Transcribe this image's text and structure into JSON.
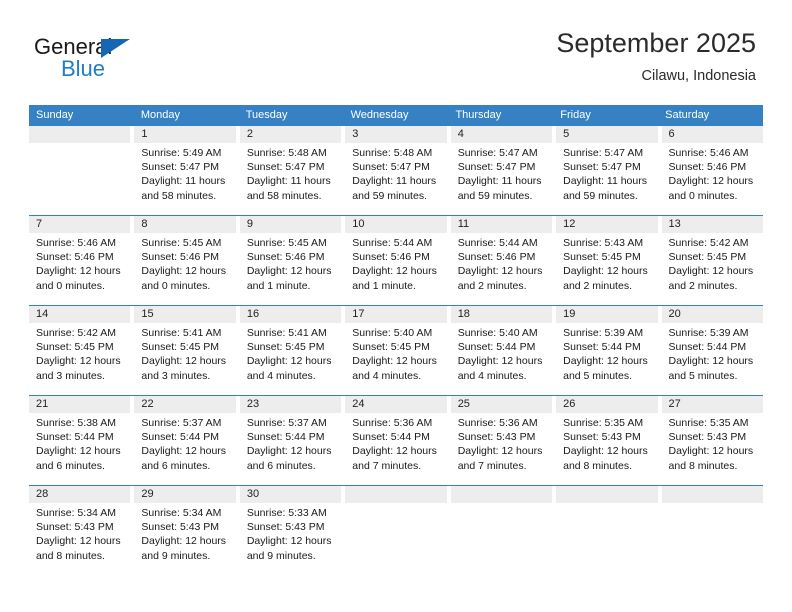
{
  "brand": {
    "name_part1": "General",
    "name_part2": "Blue",
    "triangle_icon": "blue-triangle-icon",
    "accent_color": "#1667b3",
    "blue_text_color": "#1f7ec4"
  },
  "header": {
    "title": "September 2025",
    "subtitle": "Cilawu, Indonesia"
  },
  "calendar": {
    "header_bg": "#3581c4",
    "date_band_bg": "#ededed",
    "weekdays": [
      "Sunday",
      "Monday",
      "Tuesday",
      "Wednesday",
      "Thursday",
      "Friday",
      "Saturday"
    ],
    "weeks": [
      [
        {
          "day": "",
          "sunrise": "",
          "sunset": "",
          "daylight_line1": "",
          "daylight_line2": ""
        },
        {
          "day": "1",
          "sunrise": "Sunrise: 5:49 AM",
          "sunset": "Sunset: 5:47 PM",
          "daylight_line1": "Daylight: 11 hours",
          "daylight_line2": "and 58 minutes."
        },
        {
          "day": "2",
          "sunrise": "Sunrise: 5:48 AM",
          "sunset": "Sunset: 5:47 PM",
          "daylight_line1": "Daylight: 11 hours",
          "daylight_line2": "and 58 minutes."
        },
        {
          "day": "3",
          "sunrise": "Sunrise: 5:48 AM",
          "sunset": "Sunset: 5:47 PM",
          "daylight_line1": "Daylight: 11 hours",
          "daylight_line2": "and 59 minutes."
        },
        {
          "day": "4",
          "sunrise": "Sunrise: 5:47 AM",
          "sunset": "Sunset: 5:47 PM",
          "daylight_line1": "Daylight: 11 hours",
          "daylight_line2": "and 59 minutes."
        },
        {
          "day": "5",
          "sunrise": "Sunrise: 5:47 AM",
          "sunset": "Sunset: 5:47 PM",
          "daylight_line1": "Daylight: 11 hours",
          "daylight_line2": "and 59 minutes."
        },
        {
          "day": "6",
          "sunrise": "Sunrise: 5:46 AM",
          "sunset": "Sunset: 5:46 PM",
          "daylight_line1": "Daylight: 12 hours",
          "daylight_line2": "and 0 minutes."
        }
      ],
      [
        {
          "day": "7",
          "sunrise": "Sunrise: 5:46 AM",
          "sunset": "Sunset: 5:46 PM",
          "daylight_line1": "Daylight: 12 hours",
          "daylight_line2": "and 0 minutes."
        },
        {
          "day": "8",
          "sunrise": "Sunrise: 5:45 AM",
          "sunset": "Sunset: 5:46 PM",
          "daylight_line1": "Daylight: 12 hours",
          "daylight_line2": "and 0 minutes."
        },
        {
          "day": "9",
          "sunrise": "Sunrise: 5:45 AM",
          "sunset": "Sunset: 5:46 PM",
          "daylight_line1": "Daylight: 12 hours",
          "daylight_line2": "and 1 minute."
        },
        {
          "day": "10",
          "sunrise": "Sunrise: 5:44 AM",
          "sunset": "Sunset: 5:46 PM",
          "daylight_line1": "Daylight: 12 hours",
          "daylight_line2": "and 1 minute."
        },
        {
          "day": "11",
          "sunrise": "Sunrise: 5:44 AM",
          "sunset": "Sunset: 5:46 PM",
          "daylight_line1": "Daylight: 12 hours",
          "daylight_line2": "and 2 minutes."
        },
        {
          "day": "12",
          "sunrise": "Sunrise: 5:43 AM",
          "sunset": "Sunset: 5:45 PM",
          "daylight_line1": "Daylight: 12 hours",
          "daylight_line2": "and 2 minutes."
        },
        {
          "day": "13",
          "sunrise": "Sunrise: 5:42 AM",
          "sunset": "Sunset: 5:45 PM",
          "daylight_line1": "Daylight: 12 hours",
          "daylight_line2": "and 2 minutes."
        }
      ],
      [
        {
          "day": "14",
          "sunrise": "Sunrise: 5:42 AM",
          "sunset": "Sunset: 5:45 PM",
          "daylight_line1": "Daylight: 12 hours",
          "daylight_line2": "and 3 minutes."
        },
        {
          "day": "15",
          "sunrise": "Sunrise: 5:41 AM",
          "sunset": "Sunset: 5:45 PM",
          "daylight_line1": "Daylight: 12 hours",
          "daylight_line2": "and 3 minutes."
        },
        {
          "day": "16",
          "sunrise": "Sunrise: 5:41 AM",
          "sunset": "Sunset: 5:45 PM",
          "daylight_line1": "Daylight: 12 hours",
          "daylight_line2": "and 4 minutes."
        },
        {
          "day": "17",
          "sunrise": "Sunrise: 5:40 AM",
          "sunset": "Sunset: 5:45 PM",
          "daylight_line1": "Daylight: 12 hours",
          "daylight_line2": "and 4 minutes."
        },
        {
          "day": "18",
          "sunrise": "Sunrise: 5:40 AM",
          "sunset": "Sunset: 5:44 PM",
          "daylight_line1": "Daylight: 12 hours",
          "daylight_line2": "and 4 minutes."
        },
        {
          "day": "19",
          "sunrise": "Sunrise: 5:39 AM",
          "sunset": "Sunset: 5:44 PM",
          "daylight_line1": "Daylight: 12 hours",
          "daylight_line2": "and 5 minutes."
        },
        {
          "day": "20",
          "sunrise": "Sunrise: 5:39 AM",
          "sunset": "Sunset: 5:44 PM",
          "daylight_line1": "Daylight: 12 hours",
          "daylight_line2": "and 5 minutes."
        }
      ],
      [
        {
          "day": "21",
          "sunrise": "Sunrise: 5:38 AM",
          "sunset": "Sunset: 5:44 PM",
          "daylight_line1": "Daylight: 12 hours",
          "daylight_line2": "and 6 minutes."
        },
        {
          "day": "22",
          "sunrise": "Sunrise: 5:37 AM",
          "sunset": "Sunset: 5:44 PM",
          "daylight_line1": "Daylight: 12 hours",
          "daylight_line2": "and 6 minutes."
        },
        {
          "day": "23",
          "sunrise": "Sunrise: 5:37 AM",
          "sunset": "Sunset: 5:44 PM",
          "daylight_line1": "Daylight: 12 hours",
          "daylight_line2": "and 6 minutes."
        },
        {
          "day": "24",
          "sunrise": "Sunrise: 5:36 AM",
          "sunset": "Sunset: 5:44 PM",
          "daylight_line1": "Daylight: 12 hours",
          "daylight_line2": "and 7 minutes."
        },
        {
          "day": "25",
          "sunrise": "Sunrise: 5:36 AM",
          "sunset": "Sunset: 5:43 PM",
          "daylight_line1": "Daylight: 12 hours",
          "daylight_line2": "and 7 minutes."
        },
        {
          "day": "26",
          "sunrise": "Sunrise: 5:35 AM",
          "sunset": "Sunset: 5:43 PM",
          "daylight_line1": "Daylight: 12 hours",
          "daylight_line2": "and 8 minutes."
        },
        {
          "day": "27",
          "sunrise": "Sunrise: 5:35 AM",
          "sunset": "Sunset: 5:43 PM",
          "daylight_line1": "Daylight: 12 hours",
          "daylight_line2": "and 8 minutes."
        }
      ],
      [
        {
          "day": "28",
          "sunrise": "Sunrise: 5:34 AM",
          "sunset": "Sunset: 5:43 PM",
          "daylight_line1": "Daylight: 12 hours",
          "daylight_line2": "and 8 minutes."
        },
        {
          "day": "29",
          "sunrise": "Sunrise: 5:34 AM",
          "sunset": "Sunset: 5:43 PM",
          "daylight_line1": "Daylight: 12 hours",
          "daylight_line2": "and 9 minutes."
        },
        {
          "day": "30",
          "sunrise": "Sunrise: 5:33 AM",
          "sunset": "Sunset: 5:43 PM",
          "daylight_line1": "Daylight: 12 hours",
          "daylight_line2": "and 9 minutes."
        },
        {
          "day": "",
          "sunrise": "",
          "sunset": "",
          "daylight_line1": "",
          "daylight_line2": ""
        },
        {
          "day": "",
          "sunrise": "",
          "sunset": "",
          "daylight_line1": "",
          "daylight_line2": ""
        },
        {
          "day": "",
          "sunrise": "",
          "sunset": "",
          "daylight_line1": "",
          "daylight_line2": ""
        },
        {
          "day": "",
          "sunrise": "",
          "sunset": "",
          "daylight_line1": "",
          "daylight_line2": ""
        }
      ]
    ]
  }
}
